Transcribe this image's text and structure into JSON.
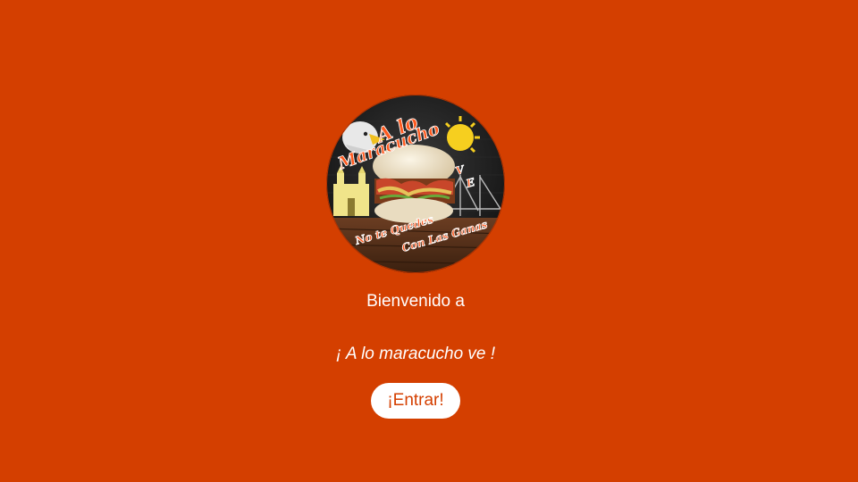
{
  "colors": {
    "background": "#d43f00",
    "button_bg": "#ffffff",
    "button_text": "#d43f00",
    "text": "#ffffff"
  },
  "logo": {
    "icon": "brand-logo-icon",
    "line1": "A lo",
    "line2": "Maracucho",
    "line3": "V E",
    "slogan1": "No te Quedes",
    "slogan2": "Con Las Ganas"
  },
  "welcome": {
    "text": "Bienvenido a"
  },
  "brand": {
    "name": "¡ A lo maracucho ve !"
  },
  "actions": {
    "enter_label": "¡Entrar!"
  }
}
